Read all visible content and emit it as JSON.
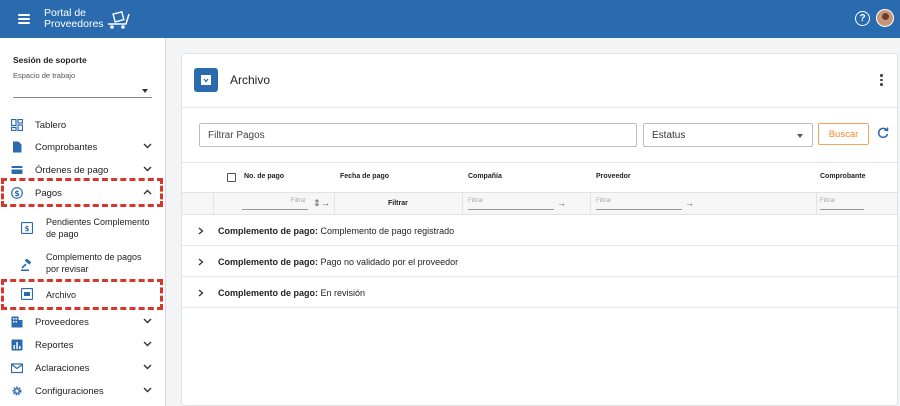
{
  "header": {
    "logo_line1": "Portal de",
    "logo_line2": "Proveedores",
    "colors": {
      "primary": "#2a6bb0"
    }
  },
  "sidebar": {
    "session_title": "Sesión de soporte",
    "workspace_label": "Espacio de trabajo",
    "items": [
      {
        "label": "Tablero",
        "icon": "dashboard-icon"
      },
      {
        "label": "Comprobantes",
        "icon": "document-icon"
      },
      {
        "label": "Órdenes de pago",
        "icon": "payment-order-icon"
      },
      {
        "label": "Pagos",
        "icon": "dollar-icon"
      },
      {
        "label": "Proveedores",
        "icon": "building-icon"
      },
      {
        "label": "Reportes",
        "icon": "chart-icon"
      },
      {
        "label": "Aclaraciones",
        "icon": "mail-icon"
      },
      {
        "label": "Configuraciones",
        "icon": "gear-icon"
      }
    ],
    "subitems": [
      {
        "label_line1": "Pendientes Complemento",
        "label_line2": "de pago",
        "icon": "pending-icon"
      },
      {
        "label_line1": "Complemento de pagos",
        "label_line2": "por revisar",
        "icon": "gavel-icon"
      },
      {
        "label_line1": "Archivo",
        "label_line2": "",
        "icon": "archive-icon"
      }
    ],
    "highlight_color": "#d9362b"
  },
  "main": {
    "title": "Archivo",
    "filter_placeholder": "Filtrar Pagos",
    "status_label": "Estatus",
    "search_label": "Buscar",
    "accent_color": "#f08a2c",
    "columns": [
      "No. de pago",
      "Fecha de pago",
      "Compañía",
      "Proveedor",
      "Comprobante"
    ],
    "filter_placeholder_small": "Filtrar",
    "filter_button": "Filtrar",
    "groups": [
      {
        "label": "Complemento de pago:",
        "value": "Complemento de pago registrado"
      },
      {
        "label": "Complemento de pago:",
        "value": "Pago no validado por el proveedor"
      },
      {
        "label": "Complemento de pago:",
        "value": "En revisión"
      }
    ]
  }
}
